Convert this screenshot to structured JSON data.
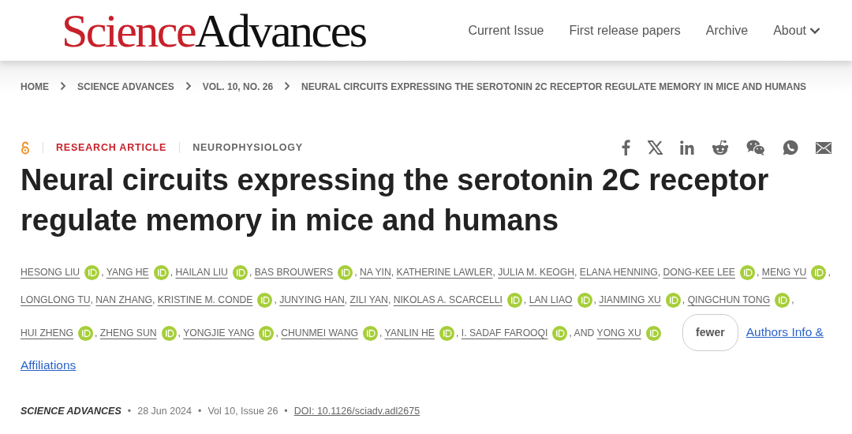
{
  "header": {
    "logo": {
      "red_part": "Science",
      "dark_part": "Advances"
    },
    "nav": [
      {
        "label": "Current Issue",
        "dropdown": false
      },
      {
        "label": "First release papers",
        "dropdown": false
      },
      {
        "label": "Archive",
        "dropdown": false
      },
      {
        "label": "About",
        "dropdown": true
      }
    ]
  },
  "breadcrumb": [
    "HOME",
    "SCIENCE ADVANCES",
    "VOL. 10, NO. 26",
    "NEURAL CIRCUITS EXPRESSING THE SEROTONIN 2C RECEPTOR REGULATE MEMORY IN MICE AND HUMANS"
  ],
  "article": {
    "open_access": true,
    "type": "RESEARCH ARTICLE",
    "subject": "NEUROPHYSIOLOGY",
    "share": [
      {
        "kind": "facebook"
      },
      {
        "kind": "x"
      },
      {
        "kind": "linkedin"
      },
      {
        "kind": "reddit"
      },
      {
        "kind": "wechat"
      },
      {
        "kind": "whatsapp"
      },
      {
        "kind": "email"
      }
    ],
    "title": "Neural circuits expressing the serotonin 2C receptor regulate memory in mice and humans",
    "author_lines": [
      [
        {
          "name": "HESONG LIU",
          "orcid": true,
          "trail": ","
        },
        {
          "name": "YANG HE",
          "orcid": true,
          "trail": ","
        },
        {
          "name": "HAILAN LIU",
          "orcid": true,
          "trail": ","
        },
        {
          "name": "BAS BROUWERS",
          "orcid": true,
          "trail": ","
        },
        {
          "name": "NA YIN",
          "orcid": false,
          "trail": ","
        },
        {
          "name": "KATHERINE LAWLER",
          "orcid": false,
          "trail": ","
        },
        {
          "name": "JULIA M. KEOGH",
          "orcid": false,
          "trail": ","
        },
        {
          "name": "ELANA HENNING",
          "orcid": false,
          "trail": ","
        },
        {
          "name": "DONG-KEE LEE",
          "orcid": true,
          "trail": ","
        },
        {
          "name": "MENG YU",
          "orcid": true,
          "trail": ","
        }
      ],
      [
        {
          "name": "LONGLONG TU",
          "orcid": false,
          "trail": ","
        },
        {
          "name": "NAN ZHANG",
          "orcid": false,
          "trail": ","
        },
        {
          "name": "KRISTINE M. CONDE",
          "orcid": true,
          "trail": ","
        },
        {
          "name": "JUNYING HAN",
          "orcid": false,
          "trail": ","
        },
        {
          "name": "ZILI YAN",
          "orcid": false,
          "trail": ","
        },
        {
          "name": "NIKOLAS A. SCARCELLI",
          "orcid": true,
          "trail": ","
        },
        {
          "name": "LAN LIAO",
          "orcid": true,
          "trail": ","
        },
        {
          "name": "JIANMING XU",
          "orcid": true,
          "trail": ","
        },
        {
          "name": "QINGCHUN TONG",
          "orcid": true,
          "trail": ","
        }
      ],
      [
        {
          "name": "HUI ZHENG",
          "orcid": true,
          "trail": ","
        },
        {
          "name": "ZHENG SUN",
          "orcid": true,
          "trail": ","
        },
        {
          "name": "YONGJIE YANG",
          "orcid": true,
          "trail": ","
        },
        {
          "name": "CHUNMEI WANG",
          "orcid": true,
          "trail": ","
        },
        {
          "name": "YANLIN HE",
          "orcid": true,
          "trail": ","
        },
        {
          "name": "I. SADAF FAROOQI",
          "orcid": true,
          "trail": ", AND"
        },
        {
          "name": "YONG XU",
          "orcid": true
        }
      ]
    ],
    "fewer_button": "fewer",
    "affiliations_link_lines": [
      "Authors Info &",
      "Affiliations"
    ],
    "meta": [
      {
        "kind": "journal",
        "text": "SCIENCE ADVANCES"
      },
      {
        "kind": "dot",
        "text": "•"
      },
      {
        "kind": "date",
        "text": "28 Jun 2024"
      },
      {
        "kind": "dot",
        "text": "•"
      },
      {
        "kind": "issue",
        "text": "Vol 10, Issue 26"
      },
      {
        "kind": "dot",
        "text": "•"
      },
      {
        "kind": "doi",
        "text": "DOI: 10.1126/sciadv.adl2675"
      }
    ]
  }
}
